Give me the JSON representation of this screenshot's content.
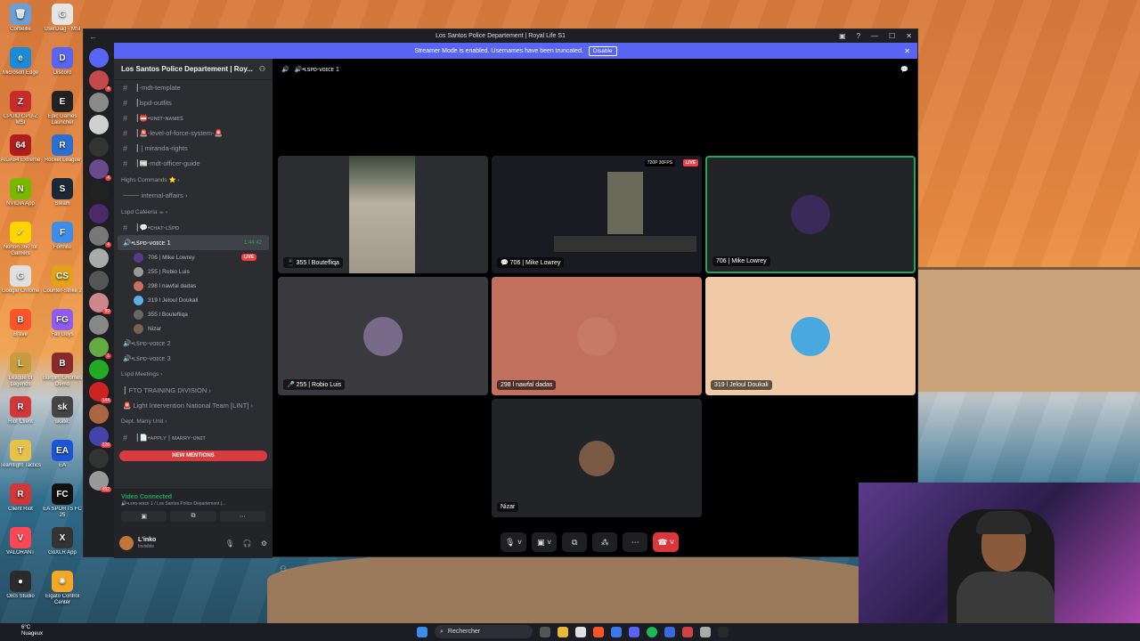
{
  "desktop": {
    "icons": [
      {
        "label": "Corbeille",
        "color": "#6aa0d8",
        "glyph": "🗑"
      },
      {
        "label": "UserDiag - MSI",
        "color": "#e5e5e5",
        "glyph": "G"
      },
      {
        "label": "Microsoft Edge",
        "color": "#1d8ad6",
        "glyph": "e"
      },
      {
        "label": "Discord",
        "color": "#5865f2",
        "glyph": "D"
      },
      {
        "label": "CPUID CPU-Z MSI",
        "color": "#c72c2c",
        "glyph": "Z"
      },
      {
        "label": "Epic Games Launcher",
        "color": "#222",
        "glyph": "E"
      },
      {
        "label": "AIDA64 Extreme",
        "color": "#b01d1d",
        "glyph": "64"
      },
      {
        "label": "Rocket League",
        "color": "#2d6fd1",
        "glyph": "R"
      },
      {
        "label": "NVIDIA App",
        "color": "#76b900",
        "glyph": "N"
      },
      {
        "label": "Steam",
        "color": "#1b2838",
        "glyph": "S"
      },
      {
        "label": "Norton 360 for Gamers",
        "color": "#ffd500",
        "glyph": "✓"
      },
      {
        "label": "Fortnite",
        "color": "#3d8ee8",
        "glyph": "F"
      },
      {
        "label": "Google Chrome",
        "color": "#e0e0e0",
        "glyph": "G"
      },
      {
        "label": "Counter-Strike 2",
        "color": "#e3a21a",
        "glyph": "CS"
      },
      {
        "label": "Brave",
        "color": "#fb542b",
        "glyph": "B"
      },
      {
        "label": "Fall Guys",
        "color": "#8e5cf5",
        "glyph": "FG"
      },
      {
        "label": "League of Legends",
        "color": "#c89b3c",
        "glyph": "L"
      },
      {
        "label": "Burglin' Gnomes Demo",
        "color": "#8a2a2a",
        "glyph": "B"
      },
      {
        "label": "Riot Client",
        "color": "#d13639",
        "glyph": "R"
      },
      {
        "label": "skate.",
        "color": "#444",
        "glyph": "sk"
      },
      {
        "label": "Teamfight Tactics",
        "color": "#e8c14a",
        "glyph": "T"
      },
      {
        "label": "EA",
        "color": "#1b55d6",
        "glyph": "EA"
      },
      {
        "label": "Client Riot",
        "color": "#d13639",
        "glyph": "R"
      },
      {
        "label": "EA SPORTS FC 25",
        "color": "#111",
        "glyph": "FC"
      },
      {
        "label": "VALORANT",
        "color": "#ff4655",
        "glyph": "V"
      },
      {
        "label": "GoXLR App",
        "color": "#333",
        "glyph": "X"
      },
      {
        "label": "OBS Studio",
        "color": "#2b2b2b",
        "glyph": "●"
      },
      {
        "label": "Elgato Control Center",
        "color": "#f5a623",
        "glyph": "✺"
      }
    ]
  },
  "window": {
    "title": "Los Santos Police Departement | Royal Life S1",
    "back_glyph": "←",
    "controls": [
      "▣",
      "?",
      "—",
      "☐",
      "✕"
    ]
  },
  "streamer_banner": {
    "text": "Streamer Mode is enabled. Usernames have been truncated.",
    "button": "Disable",
    "close": "✕"
  },
  "server": {
    "name": "Los Santos Police Departement | Roy...",
    "channels_top": [
      {
        "name": "┃-mdt-template"
      },
      {
        "name": "┃lspd-outfits"
      },
      {
        "name": "┃📛•ᴜɴɪᴛ-ɴᴀᴍᴇꜱ"
      },
      {
        "name": "┃🚨-level-of-force-system-🚨"
      },
      {
        "name": "┃ | miranda-rights"
      },
      {
        "name": "┃📰-mdt-officer-guide"
      }
    ],
    "cat_highs": "Highs Commands ⭐ ›",
    "ch_internal": "⸻ internal-affairs ›",
    "cat_cafe": "Lspd Caféeria ☕ ›",
    "ch_chat": "┃💬•ᴄʜᴀᴛ-ʟꜱᴘᴅ",
    "voice_active": {
      "name": "🔊•ʟꜱᴘᴅ-ᴠᴏɪᴄᴇ 1",
      "time": "1:44:42"
    },
    "voice_users": [
      {
        "name": "706 | Mike Lowrey",
        "live": "LIVE",
        "color": "#5a3a8a"
      },
      {
        "name": "255 | Robio Luis",
        "color": "#999"
      },
      {
        "name": "298 l nawfal dadas",
        "color": "#c87060"
      },
      {
        "name": "319 l Jeloul Doukali",
        "color": "#5ab0e0"
      },
      {
        "name": "355 l Boutefliqa",
        "color": "#666"
      },
      {
        "name": "Nizar",
        "color": "#7a6050"
      }
    ],
    "voice_2": "🔊•ʟꜱᴘᴅ-ᴠᴏɪᴄᴇ 2",
    "voice_3": "🔊•ʟꜱᴘᴅ-ᴠᴏɪᴄᴇ 3",
    "cat_meetings": "Lspd Meetings ›",
    "ch_fto": "┃ FTO TRAINING DIVISION ›",
    "ch_lint": "🚨 Light Intervention National Team [LINT] ›",
    "cat_marry": "Dept. Marry Unit ›",
    "ch_apply": "┃📄•ᴀᴘᴘʟʏ | ᴍᴀʀʀʏ-ᴜɴɪᴛ",
    "new_mentions": "NEW MENTIONS"
  },
  "voice_panel": {
    "title": "Video Connected",
    "subtitle": "🔊•ʟꜱᴘᴅ-ᴠᴏɪᴄᴇ 1 / Los Santos Police Departement |..."
  },
  "user": {
    "name": "L'inko",
    "status": "Invisible"
  },
  "stage": {
    "channel": "🔊•ʟꜱᴘᴅ-ᴠᴏɪᴄᴇ 1",
    "tiles": [
      {
        "label": "📱 355 l Boutefliqa"
      },
      {
        "label": "💬 706 | Mike Lowrey",
        "quality": "720P 30FPS",
        "live": "LIVE"
      },
      {
        "label": "706 | Mike Lowrey"
      },
      {
        "label": "🎤 255 | Robio Luis"
      },
      {
        "label": "298 l nawfal dadas"
      },
      {
        "label": "319 l Jeloul Doukali"
      },
      {
        "label": "Nizar"
      }
    ]
  },
  "taskbar": {
    "weather_temp": "6°C",
    "weather_desc": "Nuageux",
    "search": "Rechercher"
  }
}
